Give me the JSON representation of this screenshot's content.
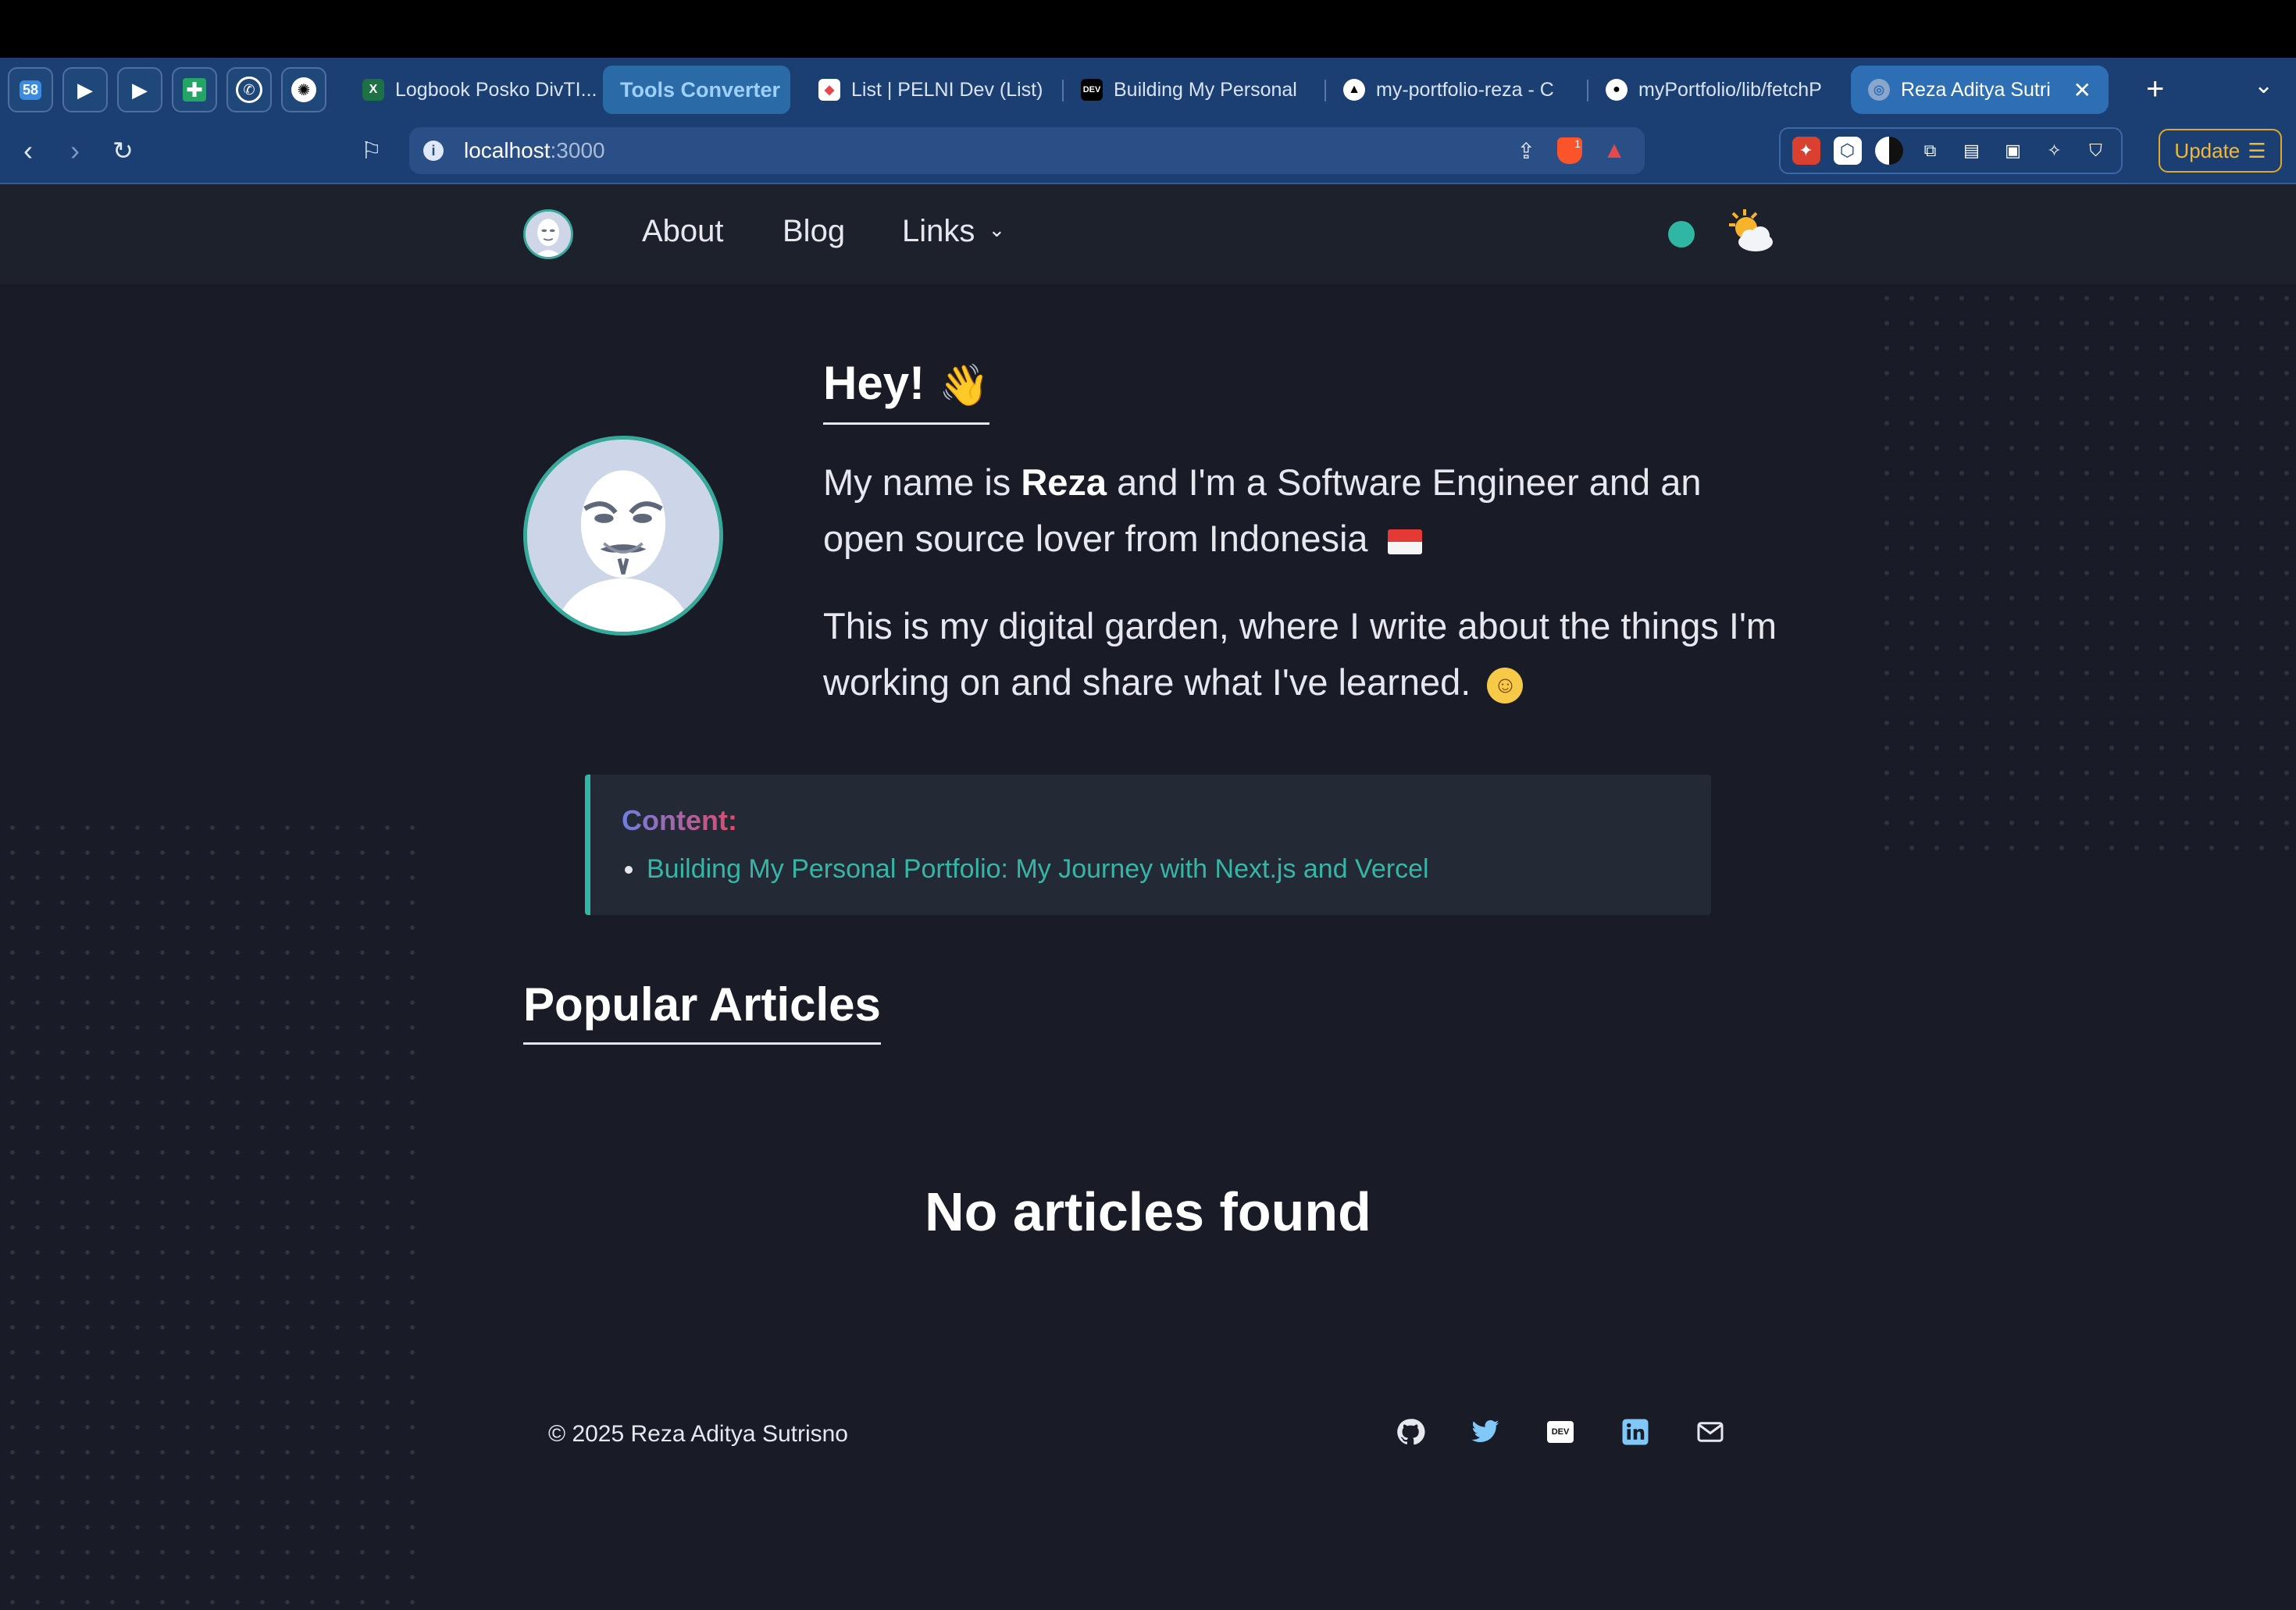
{
  "browser": {
    "tabs": [
      {
        "label": "Logbook Posko DivTI..."
      },
      {
        "label": "Tools Converter"
      },
      {
        "label": "List | PELNI Dev (List)"
      },
      {
        "label": "Building My Personal"
      },
      {
        "label": "my-portfolio-reza - C"
      },
      {
        "label": "myPortfolio/lib/fetchP"
      },
      {
        "label": "Reza Aditya Sutri"
      }
    ],
    "pinned_badge": "58",
    "url_host": "localhost",
    "url_port": ":3000",
    "brave_badge": "1",
    "update_label": "Update",
    "dev_badge": "DEV"
  },
  "nav": {
    "about": "About",
    "blog": "Blog",
    "links": "Links"
  },
  "hero": {
    "title": "Hey!",
    "wave": "👋",
    "intro_pre": "My name is ",
    "intro_name": "Reza",
    "intro_post": " and I'm a Software Engineer and an open source lover from Indonesia",
    "garden": "This is my digital garden, where I write about the things I'm working on and share what I've learned.",
    "smile": "☺"
  },
  "content": {
    "label": "Content:",
    "items": [
      {
        "title": "Building My Personal Portfolio: My Journey with Next.js and Vercel"
      }
    ]
  },
  "popular": {
    "title": "Popular Articles",
    "empty": "No articles found"
  },
  "footer": {
    "copyright": "© 2025 Reza Aditya Sutrisno",
    "dev_label": "DEV"
  },
  "colors": {
    "background": "#191c27",
    "accent": "#2fb7a4",
    "tabbar": "#1b3f73",
    "update": "#e0a92c"
  }
}
